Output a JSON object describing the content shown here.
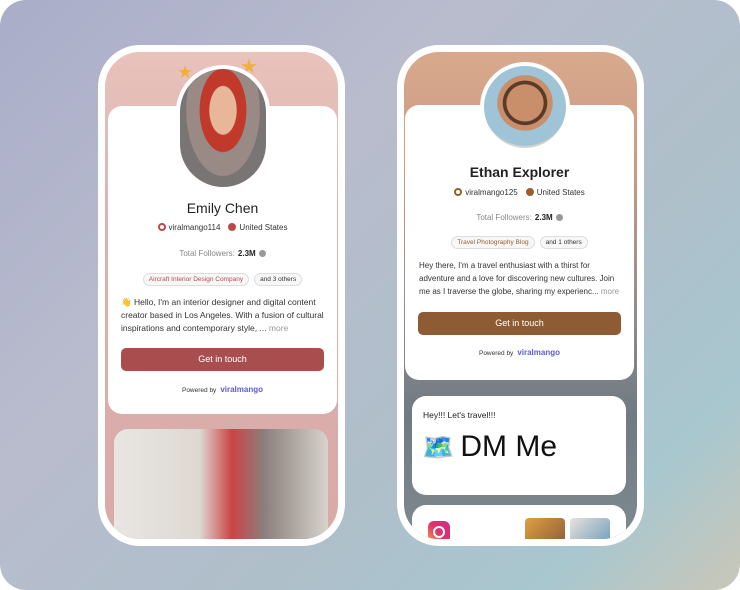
{
  "profiles": [
    {
      "name": "Emily Chen",
      "username": "viralmango114",
      "country": "United States",
      "followers_label": "Total Followers:",
      "followers": "2.3M",
      "tag": "Aircraft Interior Design Company",
      "others": "and 3 others",
      "wave": "👋",
      "bio": "Hello, I'm an interior designer and digital content creator based in Los Angeles. With a fusion of cultural inspirations and contemporary style, ...",
      "more": "more",
      "button": "Get in touch",
      "powered": "Powered by",
      "brand": "viralmango",
      "accent": "#a84e4e"
    },
    {
      "name": "Ethan Explorer",
      "username": "viralmango125",
      "country": "United States",
      "followers_label": "Total Followers:",
      "followers": "2.3M",
      "tag": "Travel Photography Blog",
      "others": "and 1 others",
      "bio": "Hey there, I'm a travel enthusiast with a thirst for adventure and a love for discovering new cultures. Join me as I traverse the globe, sharing my experienc...",
      "more": "more",
      "button": "Get in touch",
      "powered": "Powered by",
      "brand": "viralmango",
      "accent": "#8e5c32"
    }
  ],
  "dm_card": {
    "subtitle": "Hey!!! Let's travel!!!",
    "emoji": "🗺️",
    "title": "DM Me"
  }
}
